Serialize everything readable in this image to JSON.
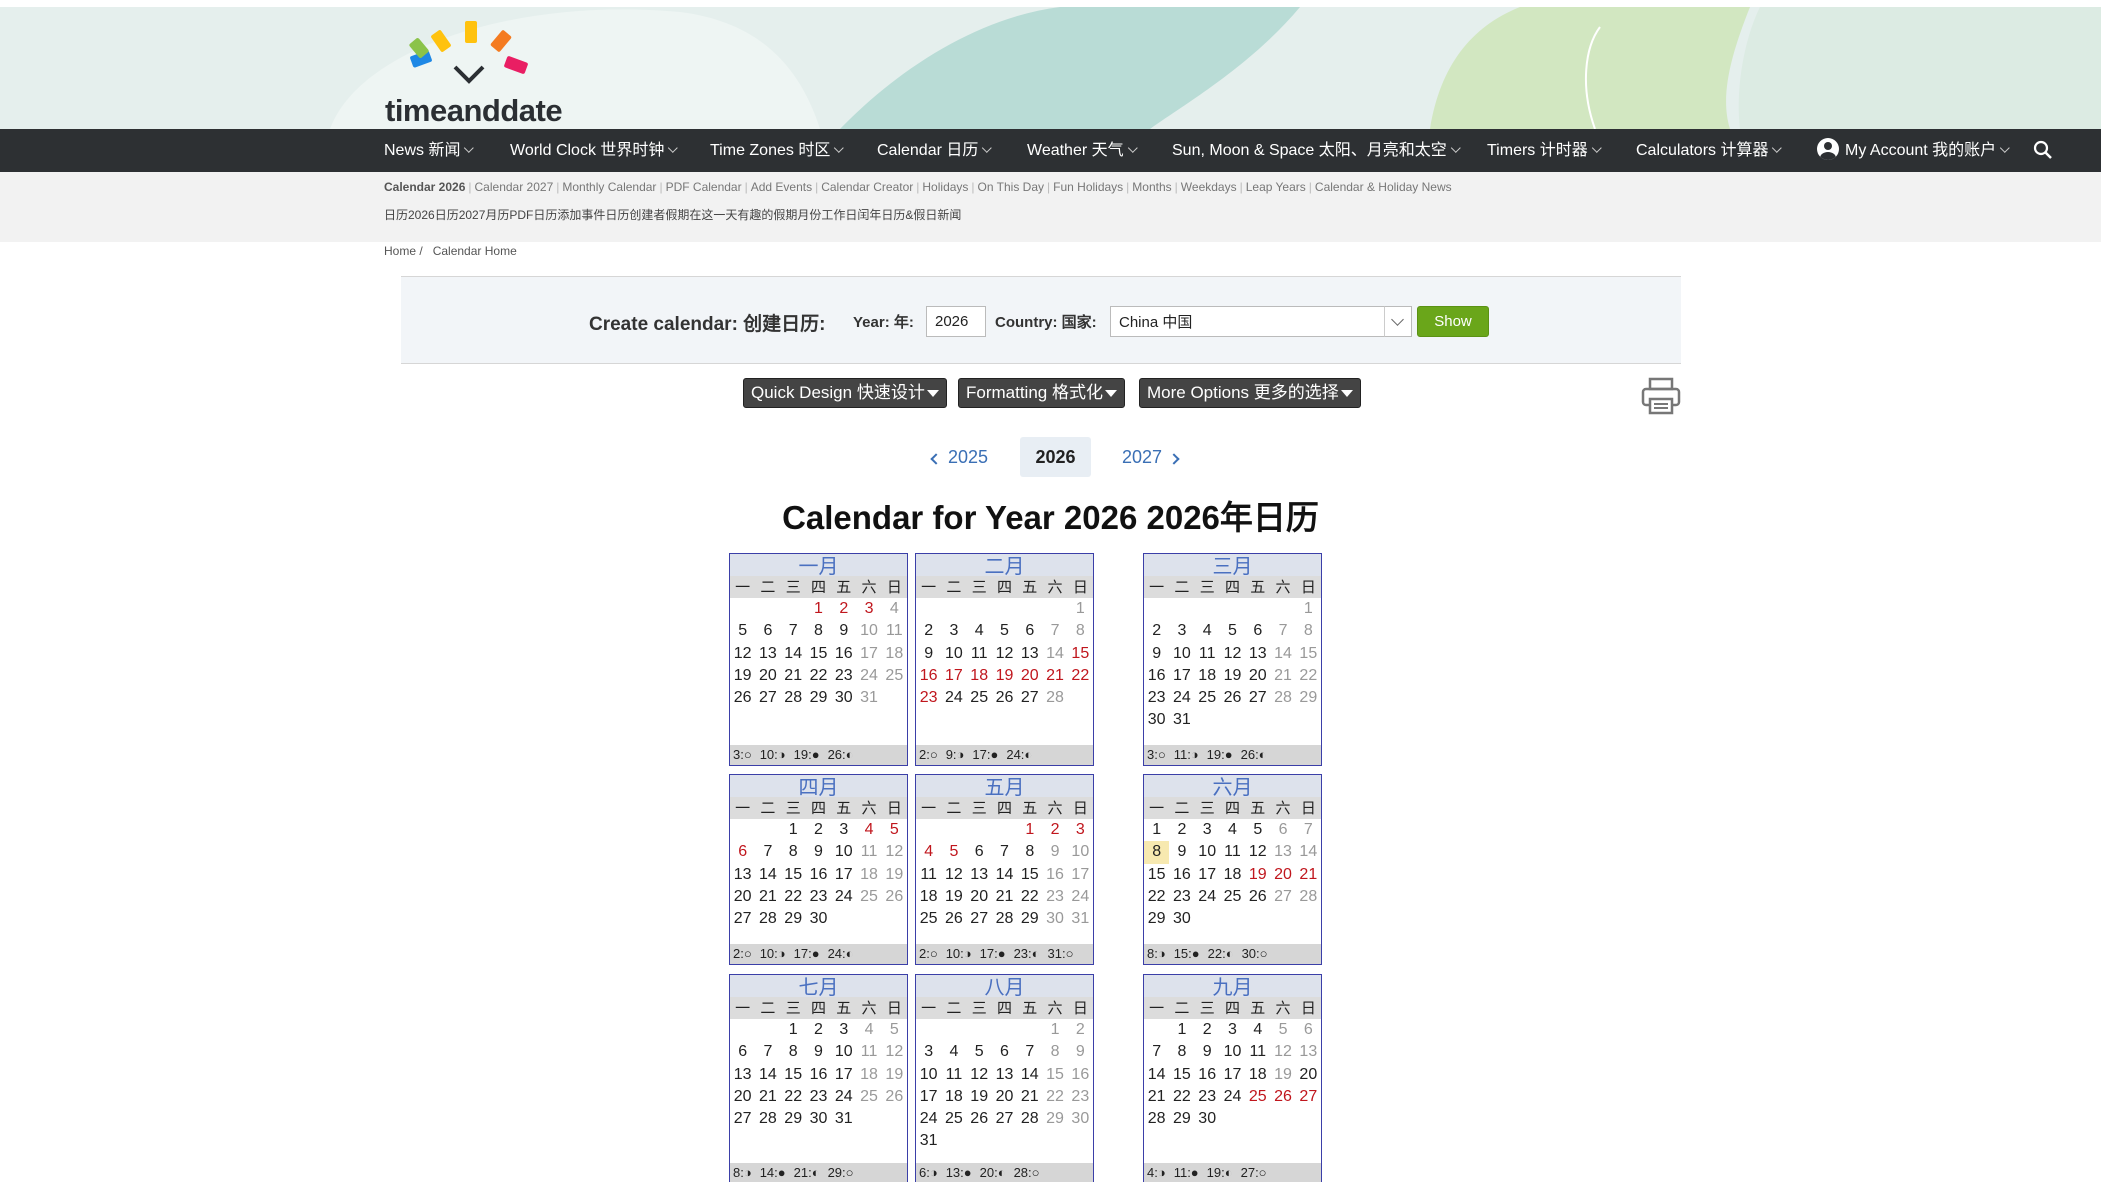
{
  "brand": {
    "name": "timeanddate"
  },
  "nav": {
    "items": [
      {
        "label": "News 新闻"
      },
      {
        "label": "World Clock 世界时钟"
      },
      {
        "label": "Time Zones 时区"
      },
      {
        "label": "Calendar 日历"
      },
      {
        "label": "Weather 天气"
      },
      {
        "label": "Sun, Moon & Space 太阳、月亮和太空"
      },
      {
        "label": "Timers 计时器"
      },
      {
        "label": "Calculators 计算器"
      },
      {
        "label": "My Account 我的账户"
      }
    ]
  },
  "subnav": {
    "links": [
      "Calendar 2026",
      "Calendar 2027",
      "Monthly Calendar",
      "PDF Calendar",
      "Add Events",
      "Calendar Creator",
      "Holidays",
      "On This Day",
      "Fun Holidays",
      "Months",
      "Weekdays",
      "Leap Years",
      "Calendar & Holiday News"
    ],
    "zh_line": "日历2026日历2027月历PDF日历添加事件日历创建者假期在这一天有趣的假期月份工作日闰年日历&假日新闻"
  },
  "breadcrumb": {
    "home": "Home /",
    "current": "Calendar Home"
  },
  "create": {
    "title": "Create calendar: 创建日历:",
    "year_label": "Year: 年:",
    "year_value": "2026",
    "country_label": "Country: 国家:",
    "country_value": "China 中国",
    "show_label": "Show"
  },
  "options": {
    "quick_design": "Quick Design 快速设计",
    "formatting": "Formatting 格式化",
    "more_options": "More Options 更多的选择"
  },
  "years": {
    "prev": "2025",
    "current": "2026",
    "next": "2027"
  },
  "title": "Calendar for Year 2026 2026年日历",
  "weekdays": [
    "一",
    "二",
    "三",
    "四",
    "五",
    "六",
    "日"
  ],
  "months": [
    {
      "name": "一月",
      "start": 3,
      "days": 31,
      "holidays": [
        1,
        2,
        3
      ],
      "phases": [
        "3:○",
        "10:◑",
        "19:●",
        "26:◐"
      ]
    },
    {
      "name": "二月",
      "start": 6,
      "days": 28,
      "holidays": [
        15,
        16,
        17,
        18,
        19,
        20,
        21,
        22,
        23
      ],
      "phases": [
        "2:○",
        "9:◑",
        "17:●",
        "24:◐"
      ]
    },
    {
      "name": "三月",
      "start": 6,
      "days": 31,
      "holidays": [],
      "phases": [
        "3:○",
        "11:◑",
        "19:●",
        "26:◐"
      ]
    },
    {
      "name": "四月",
      "start": 2,
      "days": 30,
      "holidays": [
        4,
        5,
        6
      ],
      "phases": [
        "2:○",
        "10:◑",
        "17:●",
        "24:◐"
      ]
    },
    {
      "name": "五月",
      "start": 4,
      "days": 31,
      "holidays": [
        1,
        2,
        3,
        4,
        5
      ],
      "phases": [
        "2:○",
        "10:◑",
        "17:●",
        "23:◐",
        "31:○"
      ]
    },
    {
      "name": "六月",
      "start": 0,
      "days": 30,
      "holidays": [
        19,
        20,
        21
      ],
      "today": 8,
      "phases": [
        "8:◑",
        "15:●",
        "22:◐",
        "30:○"
      ]
    },
    {
      "name": "七月",
      "start": 2,
      "days": 31,
      "holidays": [],
      "phases": [
        "8:◑",
        "14:●",
        "21:◐",
        "29:○"
      ]
    },
    {
      "name": "八月",
      "start": 5,
      "days": 31,
      "holidays": [],
      "phases": [
        "6:◑",
        "13:●",
        "20:◐",
        "28:○"
      ]
    },
    {
      "name": "九月",
      "start": 1,
      "days": 30,
      "holidays": [
        25,
        26,
        27
      ],
      "workdays_sunday": [
        20
      ],
      "phases": [
        "4:◑",
        "11:●",
        "19:◐",
        "27:○"
      ]
    }
  ]
}
